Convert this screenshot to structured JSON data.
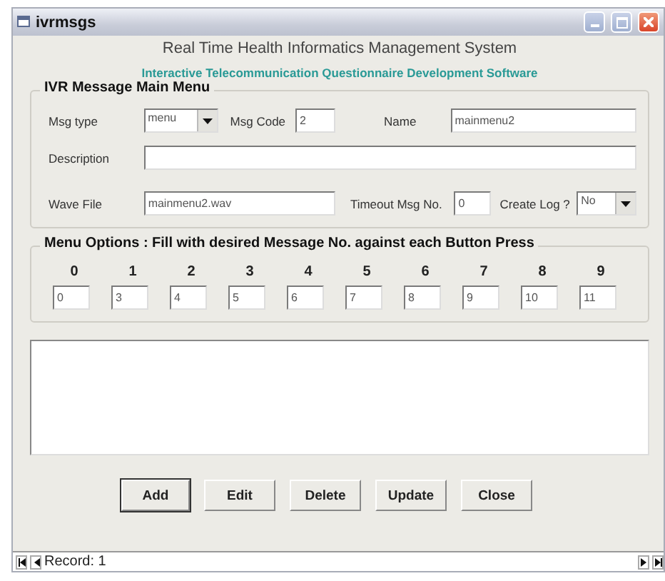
{
  "window": {
    "title": "ivrmsgs"
  },
  "header": {
    "title": "Real Time Health Informatics Management System",
    "subtitle": "Interactive Telecommunication Questionnaire Development Software"
  },
  "main_menu": {
    "legend": "IVR Message Main Menu",
    "msg_type": {
      "label": "Msg type",
      "value": "menu"
    },
    "msg_code": {
      "label": "Msg Code",
      "value": "2"
    },
    "name": {
      "label": "Name",
      "value": "mainmenu2"
    },
    "description": {
      "label": "Description"
    },
    "wave_file": {
      "label": "Wave File",
      "value": "mainmenu2.wav"
    },
    "timeout": {
      "label": "Timeout Msg No.",
      "value": "0"
    },
    "create_log": {
      "label": "Create Log ?",
      "value": "No"
    }
  },
  "menu_options": {
    "legend": "Menu Options : Fill with desired Message No. against each Button Press",
    "options": [
      {
        "key": "0",
        "value": "0"
      },
      {
        "key": "1",
        "value": "3"
      },
      {
        "key": "2",
        "value": "4"
      },
      {
        "key": "3",
        "value": "5"
      },
      {
        "key": "4",
        "value": "6"
      },
      {
        "key": "5",
        "value": "7"
      },
      {
        "key": "6",
        "value": "8"
      },
      {
        "key": "7",
        "value": "9"
      },
      {
        "key": "8",
        "value": "10"
      },
      {
        "key": "9",
        "value": "11"
      }
    ]
  },
  "buttons": [
    {
      "label": "Add",
      "default": true
    },
    {
      "label": "Edit",
      "default": false
    },
    {
      "label": "Delete",
      "default": false
    },
    {
      "label": "Update",
      "default": false
    },
    {
      "label": "Close",
      "default": false
    }
  ],
  "status_bar": {
    "record": "Record: 1"
  }
}
